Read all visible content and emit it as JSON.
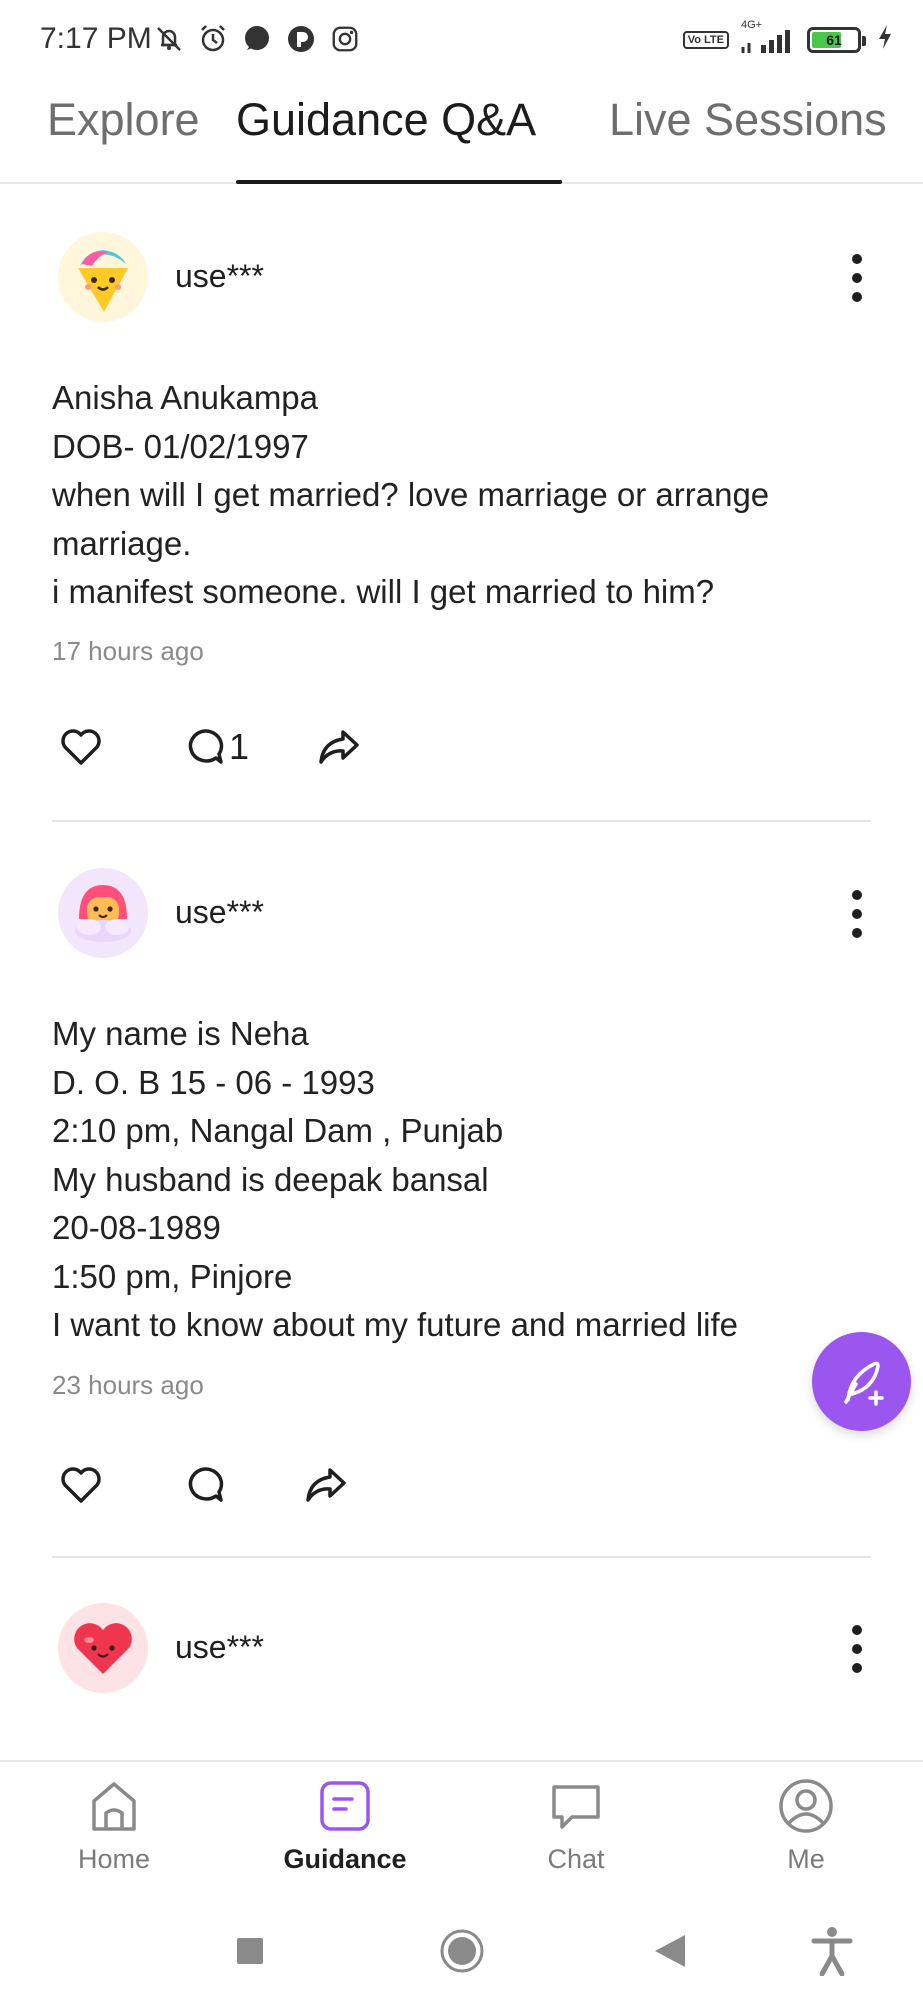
{
  "status_bar": {
    "time": "7:17 PM",
    "left_icons": [
      "muted-notifications-icon",
      "alarm-icon",
      "chat-bubble-icon",
      "app-icon",
      "instagram-icon"
    ],
    "network_label": "4G+",
    "volte_label": "Vo LTE",
    "battery_percent": "61",
    "charging": true
  },
  "tabs": [
    {
      "label": "Explore",
      "active": false
    },
    {
      "label": "Guidance Q&A",
      "active": true
    },
    {
      "label": "Live Sessions",
      "active": false
    }
  ],
  "posts": [
    {
      "username": "use***",
      "avatar": "ice-cream-avatar-icon",
      "lines": [
        "Anisha Anukampa",
        "DOB- 01/02/1997",
        "when will I get married? love marriage or arrange",
        "marriage.",
        "i manifest someone. will I get married to him?"
      ],
      "timestamp": "17 hours ago",
      "comment_count": "1"
    },
    {
      "username": "use***",
      "avatar": "hooded-girl-avatar-icon",
      "lines": [
        "My name is Neha",
        "D. O. B 15 - 06 - 1993",
        "2:10 pm, Nangal Dam , Punjab",
        "My husband is deepak bansal",
        "20-08-1989",
        "1:50 pm, Pinjore",
        "I want to know about my future and married life"
      ],
      "timestamp": "23 hours ago",
      "comment_count": ""
    },
    {
      "username": "use***",
      "avatar": "heart-avatar-icon"
    }
  ],
  "bottom_nav": [
    {
      "label": "Home",
      "icon": "home-icon",
      "active": false
    },
    {
      "label": "Guidance",
      "icon": "guidance-icon",
      "active": true
    },
    {
      "label": "Chat",
      "icon": "chat-icon",
      "active": false
    },
    {
      "label": "Me",
      "icon": "profile-icon",
      "active": false
    }
  ],
  "colors": {
    "accent": "#9b56f0",
    "battery_fill": "#49c74a",
    "divider": "#e4e4e4"
  }
}
